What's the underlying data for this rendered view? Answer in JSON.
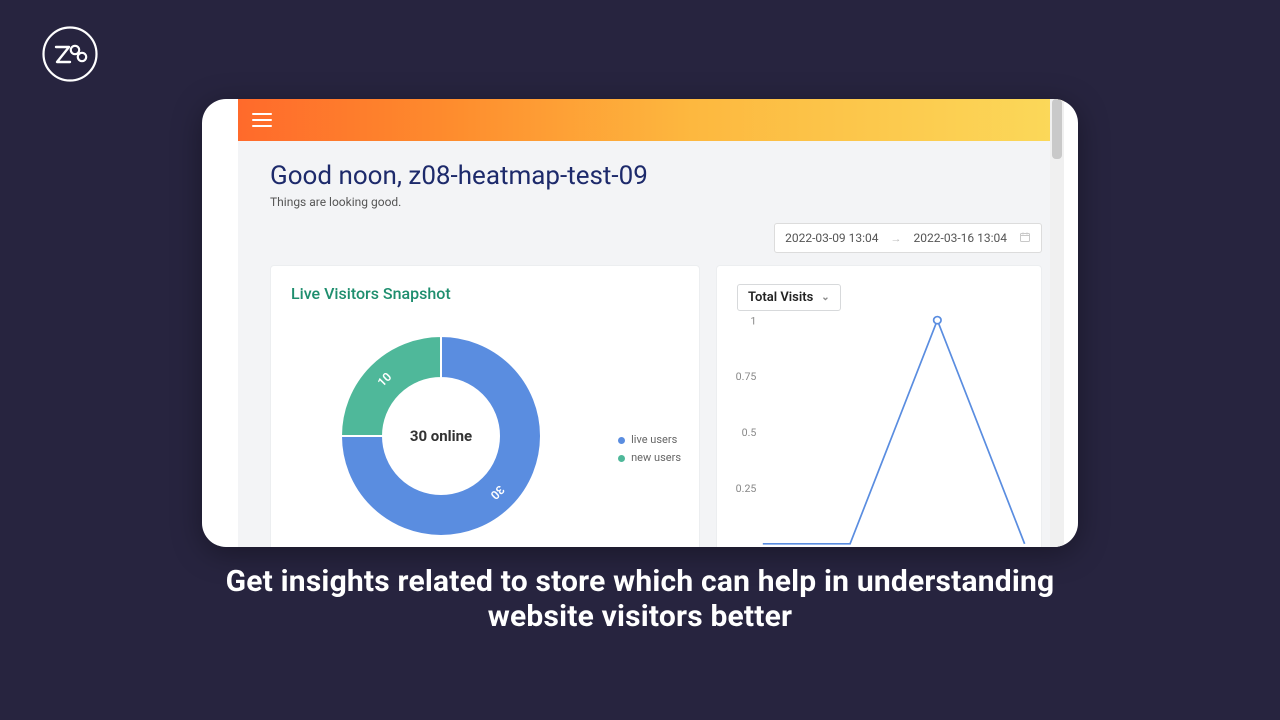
{
  "logo_text": "Z08",
  "caption_line1": "Get insights related to store which can help in understanding",
  "caption_line2": "website visitors better",
  "app": {
    "greeting_title": "Good noon, z08-heatmap-test-09",
    "greeting_sub": "Things are looking good.",
    "date_range": {
      "from": "2022-03-09 13:04",
      "to": "2022-03-16 13:04"
    },
    "left_panel": {
      "title": "Live Visitors Snapshot",
      "center_label": "30 online",
      "legend": {
        "live_label": "live users",
        "new_label": "new users"
      }
    },
    "right_panel": {
      "dropdown_label": "Total Visits"
    }
  },
  "colors": {
    "donut_live": "#5a8de0",
    "donut_new": "#4fb89a",
    "line": "#5a8de0"
  },
  "chart_data": [
    {
      "type": "pie",
      "title": "Live Visitors Snapshot",
      "series": [
        {
          "name": "live users",
          "value": 30,
          "color": "#5a8de0"
        },
        {
          "name": "new users",
          "value": 10,
          "color": "#4fb89a"
        }
      ],
      "center_text": "30 online"
    },
    {
      "type": "line",
      "title": "Total Visits",
      "ylabel": "",
      "xlabel": "",
      "ylim": [
        0,
        1
      ],
      "yticks": [
        0.25,
        0.5,
        0.75,
        1
      ],
      "x": [
        0,
        1,
        2,
        3
      ],
      "values": [
        0,
        0,
        1,
        0
      ]
    }
  ]
}
